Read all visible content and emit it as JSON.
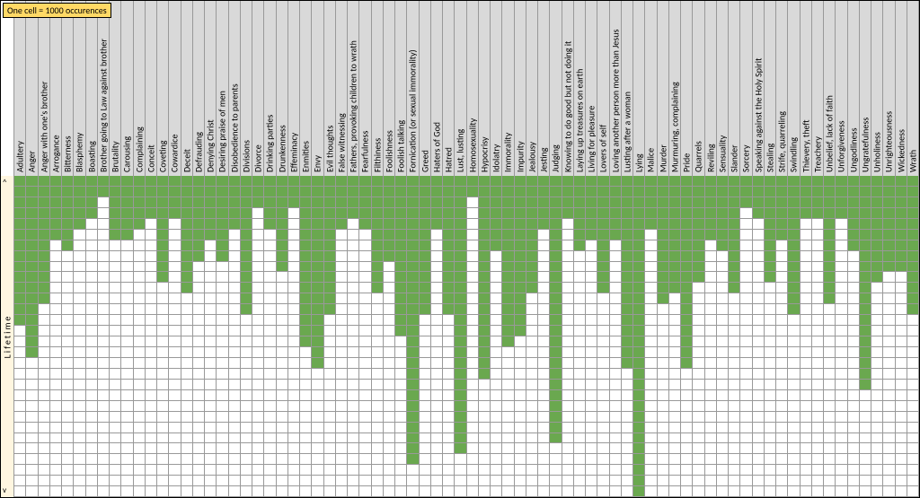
{
  "legend": "One cell = 1000 occurences",
  "yaxis": {
    "label": "Lifetime",
    "arrow_top": "^",
    "arrow_bot": "v",
    "dashing": "- - - - - - - -"
  },
  "chart_data": {
    "type": "bar",
    "orientation": "columns-top-down",
    "cell_unit": 1000,
    "rows": 30,
    "ylabel": "Lifetime",
    "title": "",
    "categories": [
      "Adultery",
      "Anger",
      "Anger with one's brother",
      "Arrogance",
      "Bitterness",
      "Blasphemy",
      "Boasting",
      "Brother going to Law against brother",
      "Brutality",
      "Carousing",
      "Complaining",
      "Conceit",
      "Coveting",
      "Cowardice",
      "Deceit",
      "Defrauding",
      "Denying Christ",
      "Desiring praise of men",
      "Disobedience to parents",
      "Divisions",
      "Divorce",
      "Drinking parties",
      "Drunkenness",
      "Effeminacy",
      "Enmities",
      "Envy",
      "Evil thoughts",
      "False witnessing",
      "Fathers, provoking children to wrath",
      "Fearfulness",
      "Filthiness",
      "Foolishness",
      "Foolish talking",
      "Fornication (or sexual immorality)",
      "Greed",
      "Haters of God",
      "Hatred",
      "Lust, lusting",
      "Homosexuality",
      "Hypocrisy",
      "Idolatry",
      "Immorality",
      "Impurity",
      "Jealousy",
      "Jesting",
      "Judging",
      "Knowing to do good but not doing it",
      "Laying up treasures on earth",
      "Living for pleasure",
      "Lovers of self",
      "Loving another person more than Jesus",
      "Lusting after a woman",
      "Lying",
      "Malice",
      "Murder",
      "Murmuring, complaining",
      "Pride",
      "Quarrels",
      "Reviling",
      "Sensuality",
      "Slander",
      "Sorcery",
      "Speaking against the Holy Spirit",
      "Stealing",
      "Strife, quarreling",
      "Swindling",
      "Thievery, theft",
      "Treachery",
      "Unbelief, lack of faith",
      "Unforgiveness",
      "Ungodliness",
      "Ungratefulness",
      "Unholiness",
      "Unrighteousness",
      "Wickedness",
      "Wrath"
    ],
    "values": [
      14,
      17,
      12,
      6,
      7,
      5,
      4,
      2,
      6,
      6,
      5,
      4,
      10,
      4,
      11,
      8,
      6,
      8,
      5,
      13,
      3,
      5,
      9,
      3,
      16,
      18,
      13,
      5,
      4,
      5,
      11,
      8,
      15,
      27,
      13,
      5,
      13,
      26,
      2,
      19,
      7,
      16,
      15,
      11,
      5,
      25,
      4,
      7,
      6,
      11,
      6,
      18,
      30,
      5,
      12,
      11,
      18,
      10,
      6,
      7,
      11,
      3,
      4,
      10,
      6,
      13,
      4,
      4,
      12,
      4,
      7,
      20,
      10,
      9,
      9,
      13
    ]
  }
}
